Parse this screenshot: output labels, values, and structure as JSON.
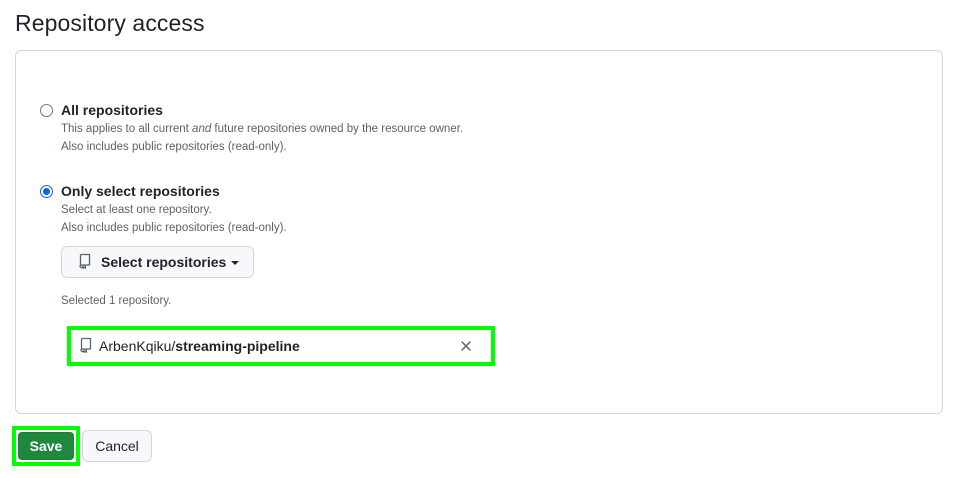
{
  "header": {
    "title": "Repository access"
  },
  "options": {
    "all": {
      "label": "All repositories",
      "desc_line1_pre": "This applies to all current ",
      "desc_line1_em": "and",
      "desc_line1_post": " future repositories owned by the resource owner.",
      "desc_line2": "Also includes public repositories (read-only).",
      "selected": false
    },
    "select": {
      "label": "Only select repositories",
      "desc_line1": "Select at least one repository.",
      "desc_line2": "Also includes public repositories (read-only).",
      "selected": true
    }
  },
  "select_button": {
    "label": "Select repositories",
    "icon": "repo-icon"
  },
  "selected_summary": "Selected 1 repository.",
  "selected_repos": [
    {
      "owner": "ArbenKqiku/",
      "name": "streaming-pipeline",
      "icon": "repo-icon",
      "remove_icon": "close-icon"
    }
  ],
  "footer": {
    "save_label": "Save",
    "cancel_label": "Cancel"
  },
  "colors": {
    "accent_blue": "#0969da",
    "save_green": "#1f883d",
    "highlight": "#00ff00",
    "muted_text": "#59636e",
    "border": "#d0d7de"
  }
}
